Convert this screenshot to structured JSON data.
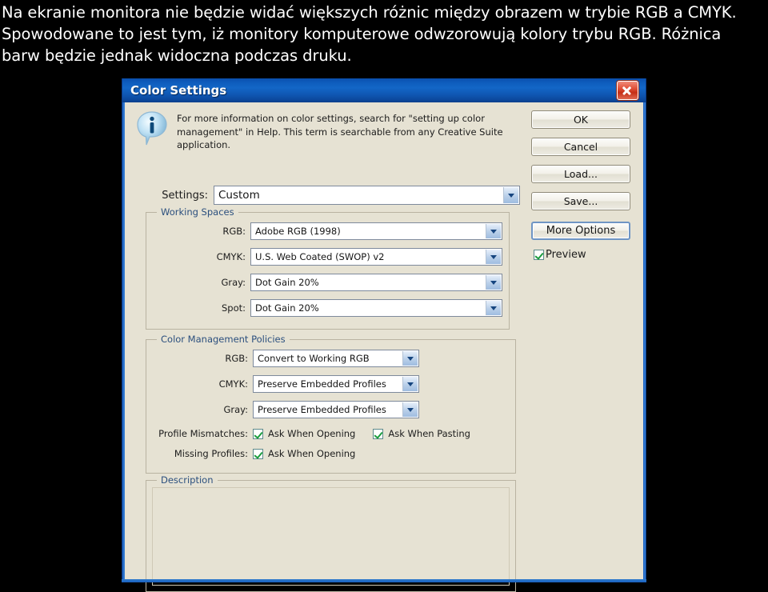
{
  "caption": {
    "lines": [
      "Na ekranie monitora nie będzie widać większych różnic między obrazem w trybie RGB a CMYK.",
      "Spowodowane to jest tym, iż monitory komputerowe odwzorowują kolory trybu RGB. Różnica",
      "barw będzie jednak widoczna podczas druku."
    ]
  },
  "dialog": {
    "title": "Color Settings",
    "close_label": "×",
    "info": {
      "icon": "info-bubble-icon",
      "text": "For more information on color settings, search for \"setting up color management\" in Help. This term is searchable from any Creative Suite application."
    },
    "settings": {
      "label": "Settings:",
      "value": "Custom"
    },
    "working_spaces": {
      "legend": "Working Spaces",
      "fields": [
        {
          "label": "RGB:",
          "value": "Adobe RGB (1998)"
        },
        {
          "label": "CMYK:",
          "value": "U.S. Web Coated (SWOP) v2"
        },
        {
          "label": "Gray:",
          "value": "Dot Gain 20%"
        },
        {
          "label": "Spot:",
          "value": "Dot Gain 20%"
        }
      ]
    },
    "policies": {
      "legend": "Color Management Policies",
      "fields": [
        {
          "label": "RGB:",
          "value": "Convert to Working RGB"
        },
        {
          "label": "CMYK:",
          "value": "Preserve Embedded Profiles"
        },
        {
          "label": "Gray:",
          "value": "Preserve Embedded Profiles"
        }
      ],
      "profile_mismatches": {
        "label": "Profile Mismatches:",
        "checkboxes": [
          {
            "label": "Ask When Opening",
            "checked": true
          },
          {
            "label": "Ask When Pasting",
            "checked": true
          }
        ]
      },
      "missing_profiles": {
        "label": "Missing Profiles:",
        "checkboxes": [
          {
            "label": "Ask When Opening",
            "checked": true
          }
        ]
      }
    },
    "description": {
      "legend": "Description",
      "text": ""
    },
    "buttons": [
      {
        "label": "OK",
        "default": false
      },
      {
        "label": "Cancel",
        "default": false
      },
      {
        "label": "Load...",
        "default": false
      },
      {
        "label": "Save...",
        "default": false
      },
      {
        "label": "More Options",
        "default": true
      }
    ],
    "preview": {
      "label": "Preview",
      "checked": true
    }
  },
  "colors": {
    "titlebar_blue": "#1366c6",
    "dialog_face": "#e6e2d3",
    "legend_text": "#2b4f7e",
    "close_red": "#c52f16",
    "check_green": "#1a9c3c",
    "combo_arrow": "#16457f",
    "page_background": "#000000"
  }
}
